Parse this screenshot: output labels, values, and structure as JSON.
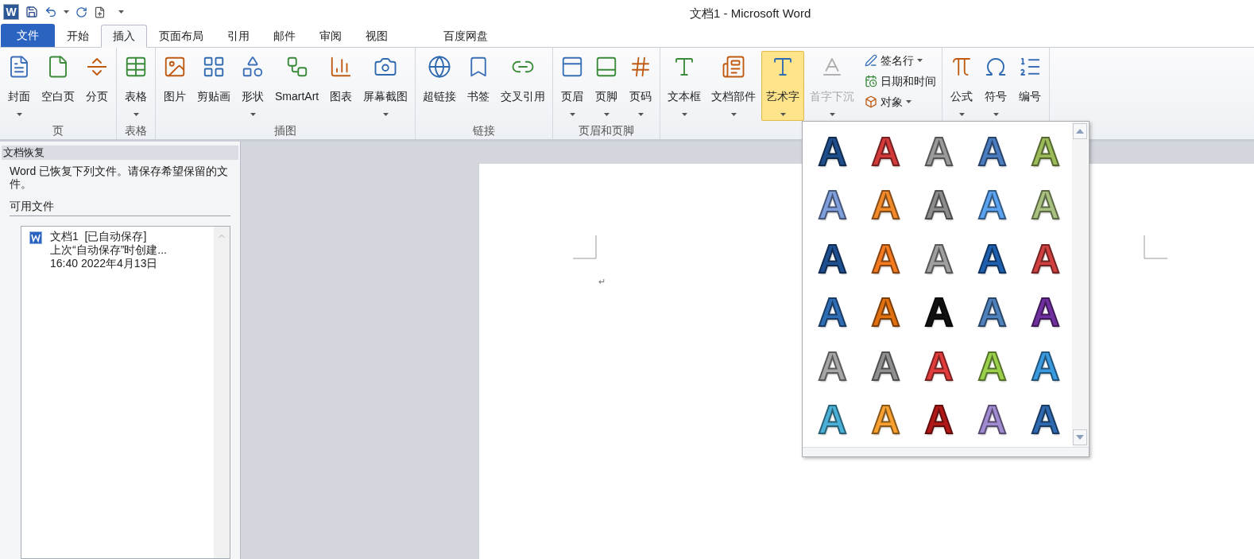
{
  "window": {
    "logo": "W",
    "title": "文档1 - Microsoft Word"
  },
  "tabs": [
    {
      "label": "文件",
      "kind": "file",
      "selected": false
    },
    {
      "label": "开始",
      "kind": "tab",
      "selected": false
    },
    {
      "label": "插入",
      "kind": "tab",
      "selected": true
    },
    {
      "label": "页面布局",
      "kind": "tab",
      "selected": false
    },
    {
      "label": "引用",
      "kind": "tab",
      "selected": false
    },
    {
      "label": "邮件",
      "kind": "tab",
      "selected": false
    },
    {
      "label": "审阅",
      "kind": "tab",
      "selected": false
    },
    {
      "label": "视图",
      "kind": "tab",
      "selected": false
    },
    {
      "label": "百度网盘",
      "kind": "tab",
      "selected": false
    }
  ],
  "ribbon": {
    "groups": [
      {
        "label": "页",
        "buttons": [
          {
            "kind": "large",
            "label": "封面",
            "dropdown": true,
            "selected": false,
            "disabled": false
          },
          {
            "kind": "large",
            "label": "空白页",
            "dropdown": false,
            "selected": false,
            "disabled": false
          },
          {
            "kind": "large",
            "label": "分页",
            "dropdown": false,
            "selected": false,
            "disabled": false
          }
        ]
      },
      {
        "label": "表格",
        "buttons": [
          {
            "kind": "large",
            "label": "表格",
            "dropdown": true,
            "selected": false,
            "disabled": false
          }
        ]
      },
      {
        "label": "插图",
        "buttons": [
          {
            "kind": "large",
            "label": "图片",
            "dropdown": false,
            "selected": false,
            "disabled": false
          },
          {
            "kind": "large",
            "label": "剪贴画",
            "dropdown": false,
            "selected": false,
            "disabled": false
          },
          {
            "kind": "large",
            "label": "形状",
            "dropdown": true,
            "selected": false,
            "disabled": false
          },
          {
            "kind": "large",
            "label": "SmartArt",
            "dropdown": false,
            "selected": false,
            "disabled": false
          },
          {
            "kind": "large",
            "label": "图表",
            "dropdown": false,
            "selected": false,
            "disabled": false
          },
          {
            "kind": "large",
            "label": "屏幕截图",
            "dropdown": true,
            "selected": false,
            "disabled": false
          }
        ]
      },
      {
        "label": "链接",
        "buttons": [
          {
            "kind": "large",
            "label": "超链接",
            "dropdown": false,
            "selected": false,
            "disabled": false
          },
          {
            "kind": "large",
            "label": "书签",
            "dropdown": false,
            "selected": false,
            "disabled": false
          },
          {
            "kind": "large",
            "label": "交叉引用",
            "dropdown": false,
            "selected": false,
            "disabled": false
          }
        ]
      },
      {
        "label": "页眉和页脚",
        "buttons": [
          {
            "kind": "large",
            "label": "页眉",
            "dropdown": true,
            "selected": false,
            "disabled": false
          },
          {
            "kind": "large",
            "label": "页脚",
            "dropdown": true,
            "selected": false,
            "disabled": false
          },
          {
            "kind": "large",
            "label": "页码",
            "dropdown": true,
            "selected": false,
            "disabled": false
          }
        ]
      },
      {
        "buttons": [
          {
            "kind": "large",
            "label": "文本框",
            "dropdown": true,
            "selected": false,
            "disabled": false
          },
          {
            "kind": "large",
            "label": "文档部件",
            "dropdown": true,
            "selected": false,
            "disabled": false
          },
          {
            "kind": "large",
            "label": "艺术字",
            "dropdown": true,
            "selected": true,
            "disabled": false
          },
          {
            "kind": "large",
            "label": "首字下沉",
            "dropdown": true,
            "selected": false,
            "disabled": true
          },
          {
            "kind": "small",
            "label": "签名行",
            "dropdown": true,
            "selected": false,
            "disabled": false
          },
          {
            "kind": "small",
            "label": "日期和时间",
            "dropdown": false,
            "selected": false,
            "disabled": false
          },
          {
            "kind": "small",
            "label": "对象",
            "dropdown": true,
            "selected": false,
            "disabled": false
          }
        ]
      },
      {
        "buttons": [
          {
            "kind": "large",
            "label": "公式",
            "dropdown": true,
            "selected": false,
            "disabled": false
          },
          {
            "kind": "large",
            "label": "符号",
            "dropdown": true,
            "selected": false,
            "disabled": false
          },
          {
            "kind": "large",
            "label": "编号",
            "dropdown": false,
            "selected": false,
            "disabled": false
          }
        ]
      }
    ]
  },
  "recovery_pane": {
    "title": "文档恢复",
    "message": "Word 已恢复下列文件。请保存希望保留的文件。",
    "section": "可用文件",
    "files": [
      {
        "name": "文档1  [已自动保存]",
        "detail": "上次“自动保存”时创建...",
        "time": "16:40 2022年4月13日"
      }
    ]
  },
  "document": {
    "paragraph_mark": "↵"
  },
  "wordart_gallery": {
    "items": [
      {
        "label": "A",
        "color": "#1f4e8c"
      },
      {
        "label": "A",
        "color": "#d33a3a"
      },
      {
        "label": "A",
        "color": "#9a9a9a"
      },
      {
        "label": "A",
        "color": "#4a7cc0"
      },
      {
        "label": "A",
        "color": "#9bbb59"
      },
      {
        "label": "A",
        "color": "#7f9fdc"
      },
      {
        "label": "A",
        "color": "#f28a2a"
      },
      {
        "label": "A",
        "color": "#8c8c8c"
      },
      {
        "label": "A",
        "color": "#5ba3f0"
      },
      {
        "label": "A",
        "color": "#a8c080"
      },
      {
        "label": "A",
        "color": "#1e4f91"
      },
      {
        "label": "A",
        "color": "#f47a20"
      },
      {
        "label": "A",
        "color": "#a0a0a0"
      },
      {
        "label": "A",
        "color": "#1f5fb0"
      },
      {
        "label": "A",
        "color": "#d04040"
      },
      {
        "label": "A",
        "color": "#2f6db5"
      },
      {
        "label": "A",
        "color": "#e07010"
      },
      {
        "label": "A",
        "color": "#111111"
      },
      {
        "label": "A",
        "color": "#4f81bd"
      },
      {
        "label": "A",
        "color": "#7030a0"
      },
      {
        "label": "A",
        "color": "#a6a6a6"
      },
      {
        "label": "A",
        "color": "#909090"
      },
      {
        "label": "A",
        "color": "#e03c3c"
      },
      {
        "label": "A",
        "color": "#9bd04a"
      },
      {
        "label": "A",
        "color": "#3a9ae0"
      },
      {
        "label": "A",
        "color": "#4ab0d8"
      },
      {
        "label": "A",
        "color": "#f8a030"
      },
      {
        "label": "A",
        "color": "#b01818"
      },
      {
        "label": "A",
        "color": "#a08ad0"
      },
      {
        "label": "A",
        "color": "#2f69b0"
      }
    ]
  }
}
